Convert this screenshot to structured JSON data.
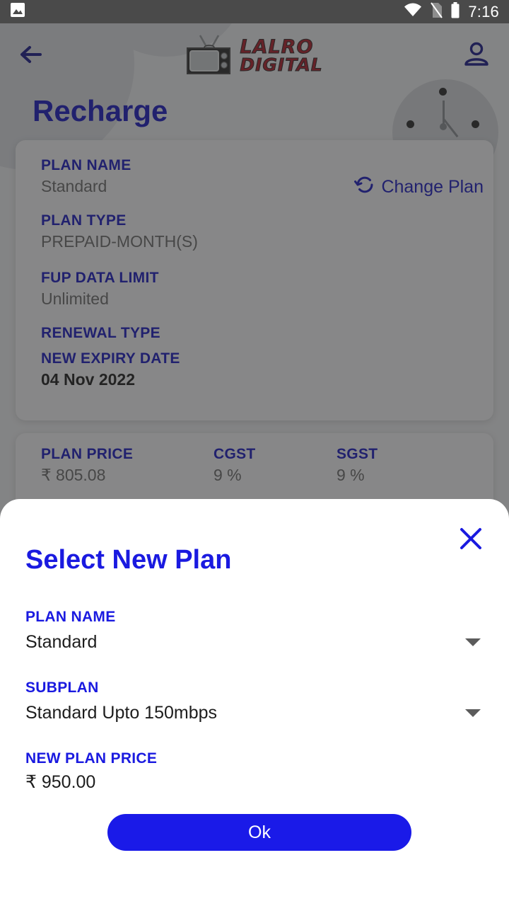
{
  "status_bar": {
    "time": "7:16",
    "icons": [
      "image-notification-icon",
      "wifi-icon",
      "no-sim-icon",
      "battery-icon"
    ]
  },
  "app_bar": {
    "back_label": "back-arrow-icon",
    "logo_line1": "LALRO",
    "logo_line2": "DIGITAL",
    "account_label": "account-icon"
  },
  "page": {
    "title": "Recharge",
    "change_plan_label": "Change Plan"
  },
  "plan_card": {
    "fields": [
      {
        "label": "PLAN NAME",
        "value": "Standard"
      },
      {
        "label": "PLAN TYPE",
        "value": "PREPAID-MONTH(S)"
      },
      {
        "label": "FUP DATA LIMIT",
        "value": "Unlimited"
      },
      {
        "label": "RENEWAL TYPE",
        "value": ""
      },
      {
        "label": "NEW EXPIRY DATE",
        "value": "04 Nov 2022"
      }
    ]
  },
  "price_card": {
    "plan_price_label": "PLAN PRICE",
    "plan_price_value": "₹ 805.08",
    "cgst_label": "CGST",
    "cgst_value": "9 %",
    "sgst_label": "SGST",
    "sgst_value": "9 %"
  },
  "bottom_sheet": {
    "title": "Select New Plan",
    "close_label": "close-icon",
    "plan_name_label": "PLAN NAME",
    "plan_name_value": "Standard",
    "subplan_label": "SUBPLAN",
    "subplan_value": "Standard Upto 150mbps",
    "new_price_label": "NEW PLAN PRICE",
    "new_price_value": "₹ 950.00",
    "ok_label": "Ok"
  },
  "colors": {
    "primary_blue": "#1a1ae0",
    "dark_blue": "#1a1ac4",
    "logo_red": "#b01c28",
    "status_bar": "#4a4a4a",
    "muted_text": "#6e6e6e"
  }
}
